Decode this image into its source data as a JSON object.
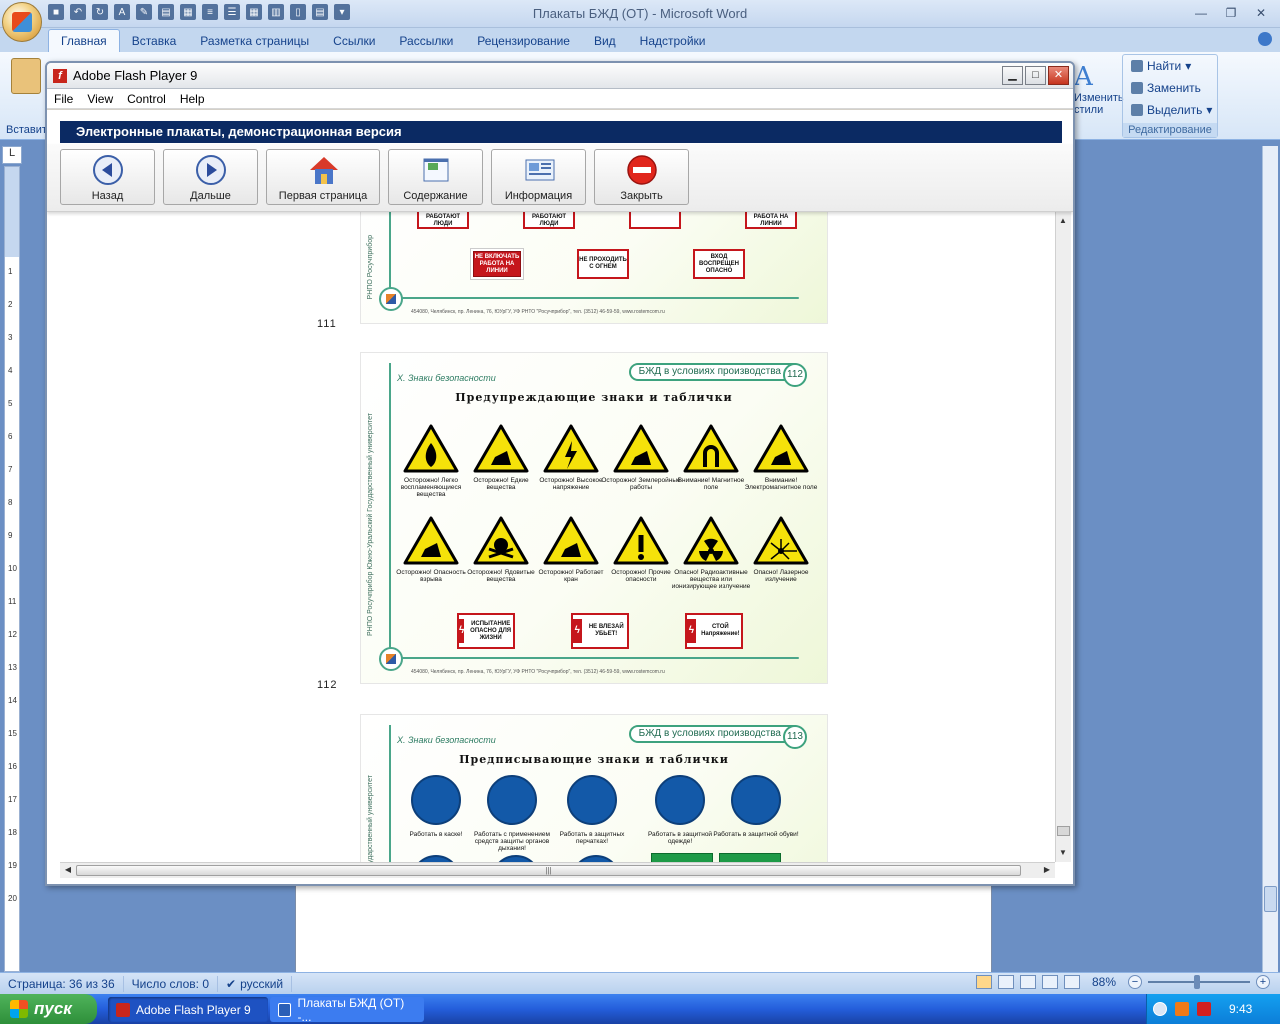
{
  "word": {
    "title": "Плакаты БЖД (ОТ) - Microsoft Word",
    "tabs": [
      "Главная",
      "Вставка",
      "Разметка страницы",
      "Ссылки",
      "Рассылки",
      "Рецензирование",
      "Вид",
      "Надстройки"
    ],
    "active_tab": "Главная",
    "paste_label": "Вставить",
    "styles_fragment": "Изменить стили",
    "editing_group": {
      "find": "Найти",
      "replace": "Заменить",
      "select": "Выделить",
      "caption": "Редактирование"
    },
    "ruler_corner": "L",
    "vruler_numbers": [
      "1",
      "2",
      "3",
      "4",
      "5",
      "6",
      "7",
      "8",
      "9",
      "10",
      "11",
      "12",
      "13",
      "14",
      "15",
      "16",
      "17",
      "18",
      "19",
      "20"
    ],
    "statusbar": {
      "page": "Страница: 36 из 36",
      "words": "Число слов: 0",
      "language": "русский",
      "zoom": "88%"
    }
  },
  "flash": {
    "title": "Adobe Flash Player 9",
    "logo_glyph": "f",
    "menu": [
      "File",
      "View",
      "Control",
      "Help"
    ],
    "banner": "Электронные плакаты, демонстрационная версия",
    "toolbar": [
      {
        "label": "Назад",
        "icon": "back-arrow-icon"
      },
      {
        "label": "Дальше",
        "icon": "forward-arrow-icon"
      },
      {
        "label": "Первая страница",
        "icon": "home-icon"
      },
      {
        "label": "Содержание",
        "icon": "contents-icon"
      },
      {
        "label": "Информация",
        "icon": "info-icon"
      },
      {
        "label": "Закрыть",
        "icon": "stop-icon"
      }
    ],
    "posters": [
      {
        "page": "111",
        "plates_top": [
          "НЕ ВКЛЮЧАТЬ РАБОТАЮТ ЛЮДИ",
          "НЕ ОТКРЫВАТЬ РАБОТАЮТ ЛЮДИ",
          "",
          "НЕ ВКЛЮЧАТЬ РАБОТА НА ЛИНИИ"
        ],
        "plates_bottom": [
          "НЕ ВКЛЮЧАТЬ РАБОТА НА ЛИНИИ",
          "НЕ ПРОХОДИТЬ С ОГНЕМ",
          "ВХОД ВОСПРЕЩЕН ОПАСНО"
        ],
        "footer": "454080, Челябинск, пр. Ленина, 76, ЮУрГУ, УФ РНТО \"Росучприбор\", тел. (3512) 46-59-59, www.rostemcom.ru",
        "vertical": "РНПО Росучприбор"
      },
      {
        "page": "112",
        "section": "Х. Знаки безопасности",
        "tag": "БЖД в условиях производства",
        "num": "112",
        "title": "Предупреждающие знаки и таблички",
        "signs": [
          "Осторожно! Легко воспламеняющиеся вещества",
          "Осторожно! Едкие вещества",
          "Осторожно! Высокое напряжение",
          "Осторожно! Землеройные работы",
          "Внимание! Магнитное поле",
          "Внимание! Электромагнитное поле",
          "Осторожно! Опасность взрыва",
          "Осторожно! Ядовитые вещества",
          "Осторожно! Работает кран",
          "Осторожно! Прочие опасности",
          "Опасно! Радиоактивные вещества или ионизирующее излучение",
          "Опасно! Лазерное излучение"
        ],
        "plates": [
          "ИСПЫТАНИЕ ОПАСНО ДЛЯ ЖИЗНИ",
          "НЕ ВЛЕЗАЙ УБЬЕТ!",
          "СТОЙ Напряжение!"
        ],
        "footer": "454080, Челябинск, пр. Ленина, 76, ЮУрГУ, УФ РНТО \"Росучприбор\", тел. (3512) 46-59-59, www.rostemcom.ru",
        "vertical": "РНПО Росучприбор   Южно-Уральский Государственный университет"
      },
      {
        "section": "Х. Знаки безопасности",
        "tag": "БЖД в условиях производства",
        "num": "113",
        "title": "Предписывающие знаки и таблички",
        "signs": [
          "Работать в каске!",
          "Работать с применением средств защиты органов дыхания!",
          "Работать в защитных перчатках!",
          "Работать в защитной одежде!",
          "Работать в защитной обуви!"
        ],
        "vertical": "Южно-Уральский Государственный университет"
      }
    ]
  },
  "taskbar": {
    "start": "пуск",
    "buttons": [
      "Adobe Flash Player 9",
      "Плакаты БЖД (ОТ) -..."
    ],
    "lang": "RU",
    "time": "9:43"
  },
  "colors": {
    "banner": "#0b2a63",
    "warning_yellow": "#f5e20a",
    "plate_red": "#c5161c",
    "mandatory_blue": "#1359a8",
    "accent_green": "#3da27e"
  }
}
